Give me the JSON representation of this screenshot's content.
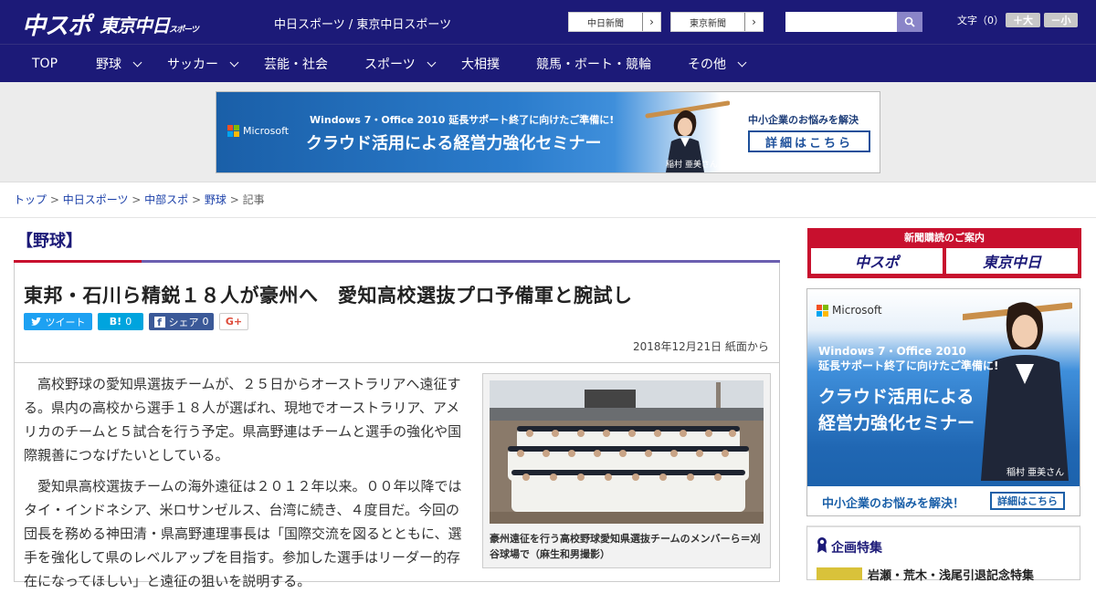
{
  "header": {
    "logo_main": "中スポ",
    "logo_sub": "東京中日",
    "logo_sub_small": "スポーツ",
    "site_links": "中日スポーツ / 東京中日スポーツ",
    "btn_chunichi": "中日新聞",
    "btn_tokyo": "東京新聞",
    "search_placeholder": "",
    "font_size_label": "文字（0）",
    "font_bigger": "＋大",
    "font_smaller": "－小"
  },
  "nav": {
    "items": [
      {
        "label": "TOP"
      },
      {
        "label": "野球"
      },
      {
        "label": "サッカー"
      },
      {
        "label": "芸能・社会"
      },
      {
        "label": "スポーツ"
      },
      {
        "label": "大相撲"
      },
      {
        "label": "競馬・ボート・競輪"
      },
      {
        "label": "その他"
      }
    ]
  },
  "banner": {
    "brand": "Microsoft",
    "line1": "Windows 7・Office 2010 延長サポート終了に向けたご準備に!",
    "line2": "クラウド活用による経営力強化セミナー",
    "person": "稲村 亜美さん",
    "right1": "中小企業のお悩みを解決",
    "right2": "詳細はこちら"
  },
  "breadcrumb": {
    "top": "トップ",
    "chunichi": "中日スポーツ",
    "chubu": "中部スポ",
    "baseball": "野球",
    "current": "記事",
    "sep": " > "
  },
  "article": {
    "category": "【野球】",
    "headline": "東邦・石川ら精鋭１８人が豪州へ　愛知高校選抜プロ予備軍と腕試し",
    "share_tweet": "ツイート",
    "share_hatena": "B!",
    "share_hatena_count": "0",
    "share_fb": "シェア",
    "share_fb_count": "0",
    "share_gplus": "G+",
    "date": "2018年12月21日 紙面から",
    "para1": "高校野球の愛知県選抜チームが、２５日からオーストラリアへ遠征する。県内の高校から選手１８人が選ばれ、現地でオーストラリア、アメリカのチームと５試合を行う予定。県高野連はチームと選手の強化や国際親善につなげたいとしている。",
    "para2": "愛知県高校選抜チームの海外遠征は２０１２年以来。００年以降ではタイ・インドネシア、米ロサンゼルス、台湾に続き、４度目だ。今回の団長を務める神田清・県高野連理事長は「国際交流を図るとともに、選手を強化して県のレベルアップを目指す。参加した選手はリーダー的存在になってほしい」と遠征の狙いを説明する。",
    "caption": "豪州遠征を行う高校野球愛知県選抜チームのメンバーら＝刈谷球場で（麻生和男撮影）"
  },
  "sidebar": {
    "subscribe_title": "新聞購読のご案内",
    "sub_logo1": "中スポ",
    "sub_logo2": "東京中日",
    "ad_brand": "Microsoft",
    "ad_line1a": "Windows 7・Office 2010",
    "ad_line1b": "延長サポート終了に向けたご準備に!",
    "ad_line2a": "クラウド活用による",
    "ad_line2b": "経営力強化セミナー",
    "ad_person": "稲村 亜美さん",
    "ad_bottom1": "中小企業のお悩みを解決！",
    "ad_bottom2": "詳細はこちら",
    "feature_title": "企画特集",
    "feature_item": "岩瀬・荒木・浅尾引退記念特集"
  },
  "colors": {
    "brand_navy": "#1c1a78",
    "accent_red": "#c8102e",
    "twitter": "#1da1f2",
    "hatena": "#00a4de",
    "facebook": "#3b5998"
  }
}
